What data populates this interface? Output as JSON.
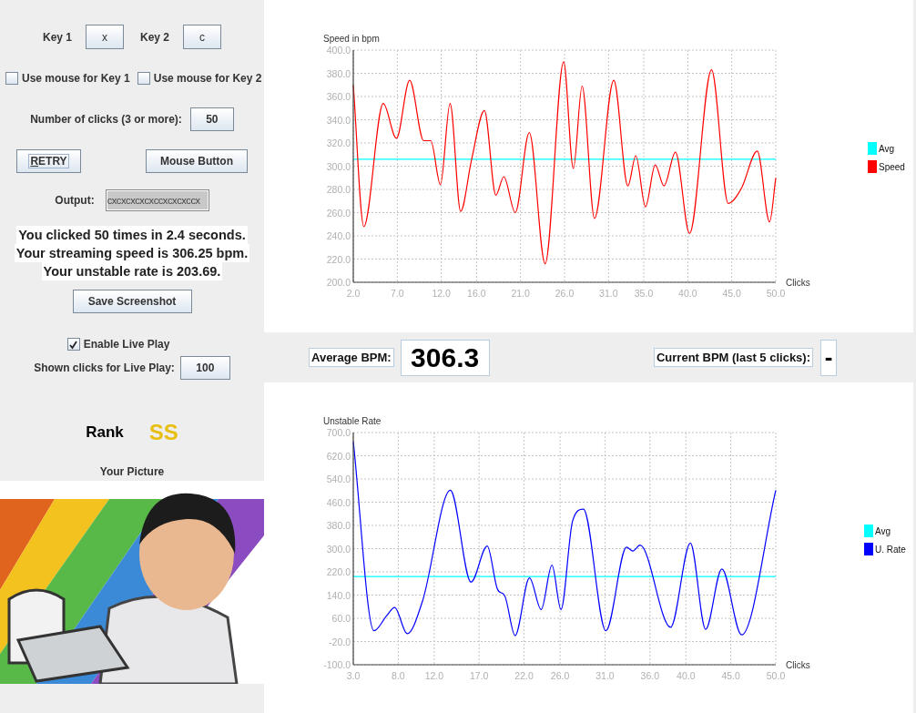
{
  "keys": [
    {
      "label": "Key 1",
      "value": "x"
    },
    {
      "label": "Key 2",
      "value": "c"
    }
  ],
  "mouse_options": [
    {
      "label": "Use mouse for Key 1",
      "checked": false
    },
    {
      "label": "Use mouse for Key 2",
      "checked": false
    }
  ],
  "clicks_field": {
    "label": "Number of clicks (3 or more):",
    "value": "50"
  },
  "retry_button": {
    "label": "RETRY"
  },
  "mouse_button": {
    "label": "Mouse Button"
  },
  "output": {
    "label": "Output:",
    "value": "cxcxcxcxcxccxcxcxccx"
  },
  "summary": [
    "You clicked 50 times in 2.4 seconds.",
    "Your streaming speed is 306.25 bpm.",
    "Your unstable rate is 203.69."
  ],
  "save_button": {
    "label": "Save Screenshot"
  },
  "live_play": {
    "label": "Enable Live Play",
    "checked": true
  },
  "shown_clicks": {
    "label": "Shown clicks for Live Play:",
    "value": "100"
  },
  "rank": {
    "label": "Rank",
    "value": "SS"
  },
  "picture": {
    "label": "Your Picture",
    "kind": "picture"
  },
  "speed_chart": {
    "chart_data": {
      "type": "line",
      "ylabel": "Speed in bpm",
      "xlabel": "Clicks",
      "x": [
        2.0,
        3.2,
        5.4,
        6.9,
        8.4,
        10.0,
        10.8,
        11.9,
        13.0,
        14.2,
        15.4,
        16.9,
        18.2,
        19.1,
        20.4,
        22.0,
        23.8,
        25.9,
        27.0,
        28.0,
        29.4,
        31.6,
        33.2,
        34.1,
        35.2,
        36.3,
        37.3,
        38.6,
        40.2,
        42.7,
        44.6,
        46.1,
        47.9,
        49.3,
        50.0
      ],
      "series": [
        {
          "name": "Avg",
          "color": "#00ffff",
          "values": [
            306,
            306,
            306,
            306,
            306,
            306,
            306,
            306,
            306,
            306,
            306,
            306,
            306,
            306,
            306,
            306,
            306,
            306,
            306,
            306,
            306,
            306,
            306,
            306,
            306,
            306,
            306,
            306,
            306,
            306,
            306,
            306,
            306,
            306,
            306
          ]
        },
        {
          "name": "Speed",
          "color": "#ff0000",
          "values": [
            370,
            248,
            354,
            324,
            374,
            322,
            322,
            284,
            354,
            261,
            304,
            348,
            275,
            291,
            260,
            329,
            216,
            390,
            298,
            369,
            255,
            374,
            283,
            309,
            265,
            301,
            283,
            312,
            242,
            383,
            268,
            281,
            313,
            252,
            290
          ]
        }
      ],
      "xlim": [
        2,
        50
      ],
      "ylim": [
        200,
        400
      ],
      "grid": true,
      "legend": true,
      "xticks": [
        {
          "value": 2,
          "label": "2.0"
        },
        {
          "value": 7,
          "label": "7.0"
        },
        {
          "value": 12,
          "label": "12.0"
        },
        {
          "value": 16,
          "label": "16.0"
        },
        {
          "value": 21,
          "label": "21.0"
        },
        {
          "value": 26,
          "label": "26.0"
        },
        {
          "value": 31,
          "label": "31.0"
        },
        {
          "value": 35,
          "label": "35.0"
        },
        {
          "value": 40,
          "label": "40.0"
        },
        {
          "value": 45,
          "label": "45.0"
        },
        {
          "value": 50,
          "label": "50.0"
        }
      ],
      "yticks": [
        {
          "value": 200,
          "label": "200.0"
        },
        {
          "value": 220,
          "label": "220.0"
        },
        {
          "value": 240,
          "label": "240.0"
        },
        {
          "value": 260,
          "label": "260.0"
        },
        {
          "value": 280,
          "label": "280.0"
        },
        {
          "value": 300,
          "label": "300.0"
        },
        {
          "value": 320,
          "label": "320.0"
        },
        {
          "value": 340,
          "label": "340.0"
        },
        {
          "value": 360,
          "label": "360.0"
        },
        {
          "value": 380,
          "label": "380.0"
        },
        {
          "value": 400,
          "label": "400.0"
        }
      ]
    }
  },
  "bpm_bar": {
    "average_label": "Average BPM:",
    "average_value": "306.3",
    "current_label": "Current BPM (last 5 clicks):",
    "current_value": "-"
  },
  "unstable_chart": {
    "chart_data": {
      "type": "line",
      "ylabel": "Unstable Rate",
      "xlabel": "Clicks",
      "x": [
        3.0,
        5.3,
        6.7,
        7.6,
        9.0,
        10.7,
        13.8,
        16.1,
        17.9,
        19.0,
        19.9,
        21.0,
        22.6,
        23.9,
        25.1,
        26.1,
        27.4,
        28.6,
        31.1,
        33.4,
        34.1,
        34.9,
        38.3,
        40.5,
        42.2,
        44.0,
        46.2,
        50.0
      ],
      "series": [
        {
          "name": "Avg",
          "color": "#00ffff",
          "values": [
            204,
            204,
            204,
            204,
            204,
            204,
            204,
            204,
            204,
            204,
            204,
            204,
            204,
            204,
            204,
            204,
            204,
            204,
            204,
            204,
            204,
            204,
            204,
            204,
            204,
            204,
            204,
            204
          ]
        },
        {
          "name": "U. Rate",
          "color": "#0000ff",
          "values": [
            669,
            17,
            68,
            97,
            7,
            119,
            501,
            185,
            309,
            163,
            134,
            0,
            199,
            90,
            243,
            90,
            396,
            436,
            17,
            305,
            292,
            312,
            29,
            319,
            22,
            230,
            3,
            501
          ]
        }
      ],
      "xlim": [
        3,
        50
      ],
      "ylim": [
        -100,
        700
      ],
      "grid": true,
      "legend": true,
      "xticks": [
        {
          "value": 3,
          "label": "3.0"
        },
        {
          "value": 8,
          "label": "8.0"
        },
        {
          "value": 12,
          "label": "12.0"
        },
        {
          "value": 17,
          "label": "17.0"
        },
        {
          "value": 22,
          "label": "22.0"
        },
        {
          "value": 26,
          "label": "26.0"
        },
        {
          "value": 31,
          "label": "31.0"
        },
        {
          "value": 36,
          "label": "36.0"
        },
        {
          "value": 40,
          "label": "40.0"
        },
        {
          "value": 45,
          "label": "45.0"
        },
        {
          "value": 50,
          "label": "50.0"
        }
      ],
      "yticks": [
        {
          "value": -100,
          "label": "-100.0"
        },
        {
          "value": -20,
          "label": "-20.0"
        },
        {
          "value": 60,
          "label": "60.0"
        },
        {
          "value": 140,
          "label": "140.0"
        },
        {
          "value": 220,
          "label": "220.0"
        },
        {
          "value": 300,
          "label": "300.0"
        },
        {
          "value": 380,
          "label": "380.0"
        },
        {
          "value": 460,
          "label": "460.0"
        },
        {
          "value": 540,
          "label": "540.0"
        },
        {
          "value": 620,
          "label": "620.0"
        },
        {
          "value": 700,
          "label": "700.0"
        }
      ]
    }
  }
}
